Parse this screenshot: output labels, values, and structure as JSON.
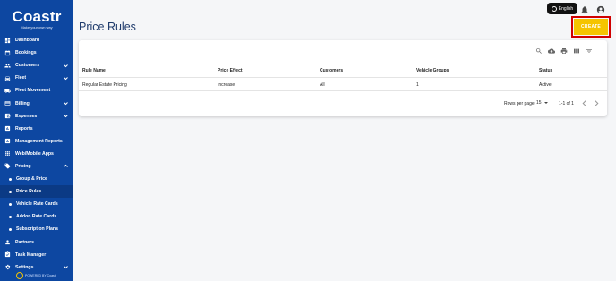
{
  "brand": {
    "logo_text": "Coastr",
    "tagline": "Make your own way",
    "powered_by": "POWERED BY Coastr"
  },
  "sidebar": {
    "items": [
      {
        "label": "Dashboard",
        "icon": "dashboard-icon",
        "expandable": false
      },
      {
        "label": "Bookings",
        "icon": "bookings-icon",
        "expandable": false
      },
      {
        "label": "Customers",
        "icon": "customers-icon",
        "expandable": true
      },
      {
        "label": "Fleet",
        "icon": "car-icon",
        "expandable": true
      },
      {
        "label": "Fleet Movement",
        "icon": "truck-icon",
        "expandable": false
      },
      {
        "label": "Billing",
        "icon": "billing-icon",
        "expandable": true
      },
      {
        "label": "Expenses",
        "icon": "expenses-icon",
        "expandable": true
      },
      {
        "label": "Reports",
        "icon": "reports-icon",
        "expandable": false
      },
      {
        "label": "Management Reports",
        "icon": "management-reports-icon",
        "expandable": false
      },
      {
        "label": "Web/Mobile Apps",
        "icon": "apps-icon",
        "expandable": false
      },
      {
        "label": "Pricing",
        "icon": "tag-icon",
        "expandable": true,
        "expanded": true
      },
      {
        "label": "Group & Price",
        "sub": true
      },
      {
        "label": "Price Rules",
        "sub": true,
        "active": true
      },
      {
        "label": "Vehicle Rate Cards",
        "sub": true
      },
      {
        "label": "Addon Rate Cards",
        "sub": true
      },
      {
        "label": "Subscription Plans",
        "sub": true
      },
      {
        "label": "Partners",
        "icon": "partners-icon",
        "expandable": false
      },
      {
        "label": "Task Manager",
        "icon": "task-icon",
        "expandable": false
      },
      {
        "label": "Settings",
        "icon": "gear-icon",
        "expandable": true
      }
    ]
  },
  "topbar": {
    "language": "English"
  },
  "page": {
    "title": "Price Rules",
    "create_label": "CREATE"
  },
  "table": {
    "columns": [
      "Rule Name",
      "Price Effect",
      "Customers",
      "Vehicle Groups",
      "Status"
    ],
    "rows": [
      [
        "Regular Estate Pricing",
        "Increase",
        "All",
        "1",
        "Active"
      ]
    ]
  },
  "pagination": {
    "rows_per_page_label": "Rows per page:",
    "rows_per_page": "15",
    "range": "1-1 of 1"
  },
  "colors": {
    "sidebar_bg": "#0d47a1",
    "title": "#1e3a6b",
    "create_bg": "#f5c400",
    "highlight": "#d00000"
  }
}
